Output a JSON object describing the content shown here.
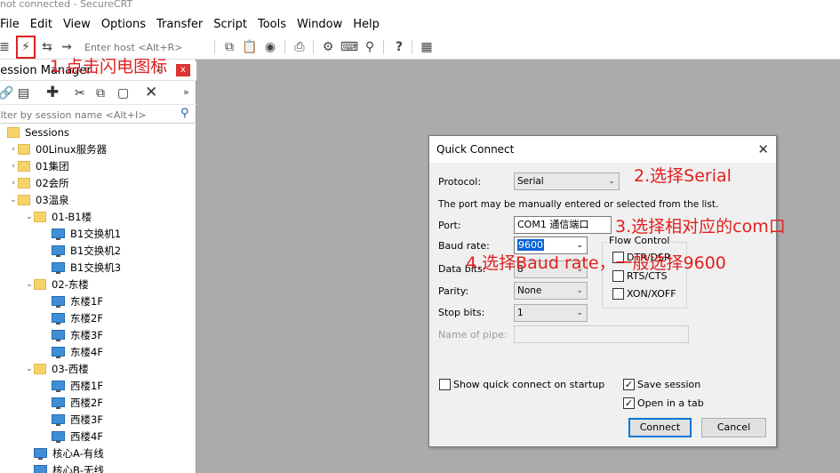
{
  "window": {
    "title": "not connected - SecureCRT"
  },
  "menu": [
    "File",
    "Edit",
    "View",
    "Options",
    "Transfer",
    "Script",
    "Tools",
    "Window",
    "Help"
  ],
  "toolbar": {
    "host_placeholder": "Enter host <Alt+R>"
  },
  "session_manager": {
    "title": "Session Manager",
    "pin": "‡",
    "close": "x",
    "filter_placeholder": "Filter by session name <Alt+I>",
    "tree": [
      {
        "label": "Sessions",
        "type": "folder",
        "level": 0,
        "chevron": ""
      },
      {
        "label": "00Linux服务器",
        "type": "folder",
        "level": 1,
        "chevron": "›"
      },
      {
        "label": "01集团",
        "type": "folder",
        "level": 1,
        "chevron": "›"
      },
      {
        "label": "02会所",
        "type": "folder",
        "level": 1,
        "chevron": "›"
      },
      {
        "label": "03温泉",
        "type": "folder",
        "level": 1,
        "chevron": "⌄"
      },
      {
        "label": "01-B1楼",
        "type": "folder",
        "level": 2,
        "chevron": "⌄"
      },
      {
        "label": "B1交换机1",
        "type": "session",
        "level": 3,
        "chevron": ""
      },
      {
        "label": "B1交换机2",
        "type": "session",
        "level": 3,
        "chevron": ""
      },
      {
        "label": "B1交换机3",
        "type": "session",
        "level": 3,
        "chevron": ""
      },
      {
        "label": "02-东楼",
        "type": "folder",
        "level": 2,
        "chevron": "⌄"
      },
      {
        "label": "东楼1F",
        "type": "session",
        "level": 3,
        "chevron": ""
      },
      {
        "label": "东楼2F",
        "type": "session",
        "level": 3,
        "chevron": ""
      },
      {
        "label": "东楼3F",
        "type": "session",
        "level": 3,
        "chevron": ""
      },
      {
        "label": "东楼4F",
        "type": "session",
        "level": 3,
        "chevron": ""
      },
      {
        "label": "03-西楼",
        "type": "folder",
        "level": 2,
        "chevron": "⌄"
      },
      {
        "label": "西楼1F",
        "type": "session",
        "level": 3,
        "chevron": ""
      },
      {
        "label": "西楼2F",
        "type": "session",
        "level": 3,
        "chevron": ""
      },
      {
        "label": "西楼3F",
        "type": "session",
        "level": 3,
        "chevron": ""
      },
      {
        "label": "西楼4F",
        "type": "session",
        "level": 3,
        "chevron": ""
      },
      {
        "label": "核心A-有线",
        "type": "session",
        "level": 2,
        "chevron": ""
      },
      {
        "label": "核心B-无线",
        "type": "session",
        "level": 2,
        "chevron": ""
      }
    ]
  },
  "dialog": {
    "title": "Quick Connect",
    "close": "✕",
    "protocol_label": "Protocol:",
    "protocol_value": "Serial",
    "port_hint": "The port may be manually entered or selected from the list.",
    "port_label": "Port:",
    "port_value": "COM1 通信端口",
    "baud_label": "Baud rate:",
    "baud_value": "9600",
    "data_bits_label": "Data bits:",
    "data_bits_value": "8",
    "parity_label": "Parity:",
    "parity_value": "None",
    "stop_bits_label": "Stop bits:",
    "stop_bits_value": "1",
    "pipe_label": "Name of pipe:",
    "flow_control_title": "Flow Control",
    "flow_dtr": "DTR/DSR",
    "flow_rts": "RTS/CTS",
    "flow_xon": "XON/XOFF",
    "show_on_startup": "Show quick connect on startup",
    "save_session": "Save session",
    "open_in_tab": "Open in a tab",
    "connect": "Connect",
    "cancel": "Cancel",
    "check_mark": "✓"
  },
  "annotations": {
    "step1": "1.点击闪电图标",
    "step2": "2.选择Serial",
    "step3": "3.选择相对应的com口",
    "step4": "4.选择Baud rate，一般选择9600",
    "color": "#e02020"
  }
}
